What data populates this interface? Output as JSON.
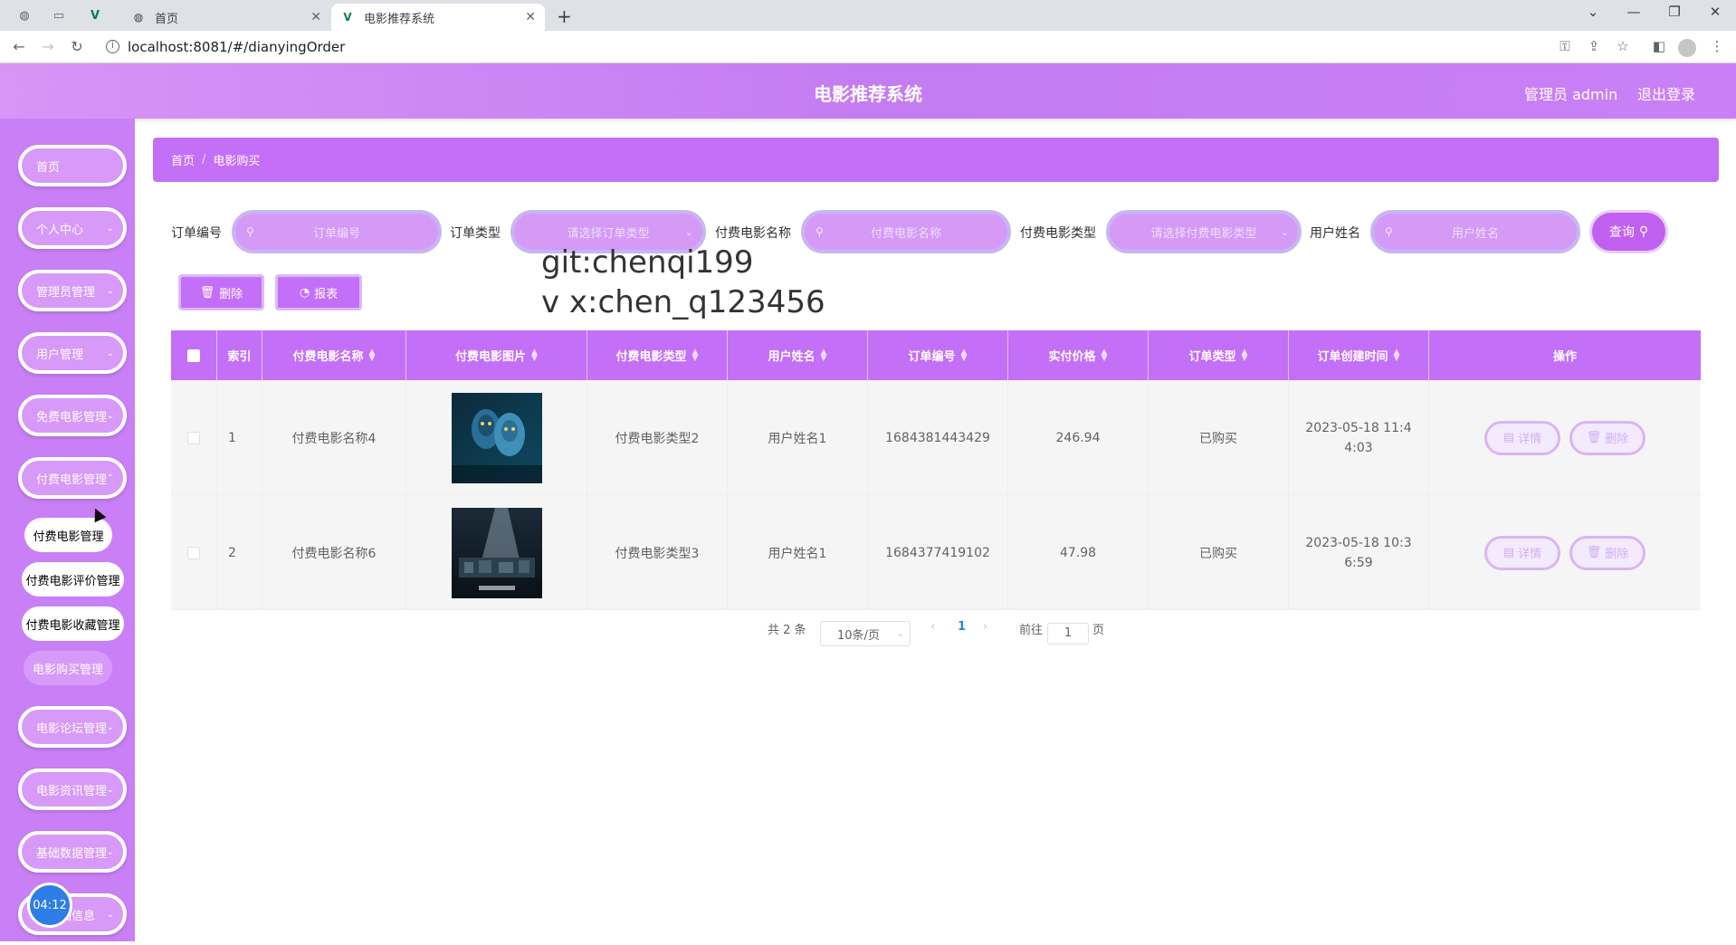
{
  "browser": {
    "tabs": [
      {
        "title": "首页",
        "active": false
      },
      {
        "title": "电影推荐系统",
        "active": true
      }
    ],
    "url": "localhost:8081/#/dianyingOrder"
  },
  "header": {
    "title": "电影推荐系统",
    "user": "管理员 admin",
    "logout": "退出登录"
  },
  "sidebar": {
    "items": [
      {
        "label": "首页"
      },
      {
        "label": "个人中心"
      },
      {
        "label": "管理员管理"
      },
      {
        "label": "用户管理"
      },
      {
        "label": "免费电影管理"
      },
      {
        "label": "付费电影管理"
      },
      {
        "label": "电影论坛管理"
      },
      {
        "label": "电影资讯管理"
      },
      {
        "label": "基础数据管理"
      },
      {
        "label": "轮播图信息"
      }
    ],
    "subitems": [
      {
        "label": "付费电影管理"
      },
      {
        "label": "付费电影评价管理"
      },
      {
        "label": "付费电影收藏管理"
      },
      {
        "label": "电影购买管理"
      }
    ],
    "timer": "04:12"
  },
  "breadcrumb": {
    "home": "首页",
    "sep": "/",
    "current": "电影购买"
  },
  "filters": {
    "order_no": {
      "label": "订单编号",
      "placeholder": "订单编号"
    },
    "order_type": {
      "label": "订单类型",
      "placeholder": "请选择订单类型"
    },
    "movie_name": {
      "label": "付费电影名称",
      "placeholder": "付费电影名称"
    },
    "movie_type": {
      "label": "付费电影类型",
      "placeholder": "请选择付费电影类型"
    },
    "user_name": {
      "label": "用户姓名",
      "placeholder": "用户姓名"
    },
    "query": "查询"
  },
  "actions": {
    "delete": "删除",
    "report": "报表"
  },
  "watermark": {
    "line1": "git:chenqi199",
    "line2": "v x:chen_q123456"
  },
  "table": {
    "headers": [
      "索引",
      "付费电影名称",
      "付费电影图片",
      "付费电影类型",
      "用户姓名",
      "订单编号",
      "实付价格",
      "订单类型",
      "订单创建时间",
      "操作"
    ],
    "rows": [
      {
        "index": "1",
        "name": "付费电影名称4",
        "type": "付费电影类型2",
        "user": "用户姓名1",
        "order_no": "1684381443429",
        "price": "246.94",
        "order_type": "已购买",
        "created": "2023-05-18 11:44:03"
      },
      {
        "index": "2",
        "name": "付费电影名称6",
        "type": "付费电影类型3",
        "user": "用户姓名1",
        "order_no": "1684377419102",
        "price": "47.98",
        "order_type": "已购买",
        "created": "2023-05-18 10:36:59"
      }
    ],
    "ops": {
      "detail": "详情",
      "delete": "删除"
    }
  },
  "pagination": {
    "total": "共 2 条",
    "page_size": "10条/页",
    "current": "1",
    "goto": "前往",
    "goto_value": "1",
    "page_unit": "页"
  },
  "colors": {
    "accent": "#c46ff7",
    "sidebar": "#c980f6",
    "link": "#1e88e5"
  }
}
